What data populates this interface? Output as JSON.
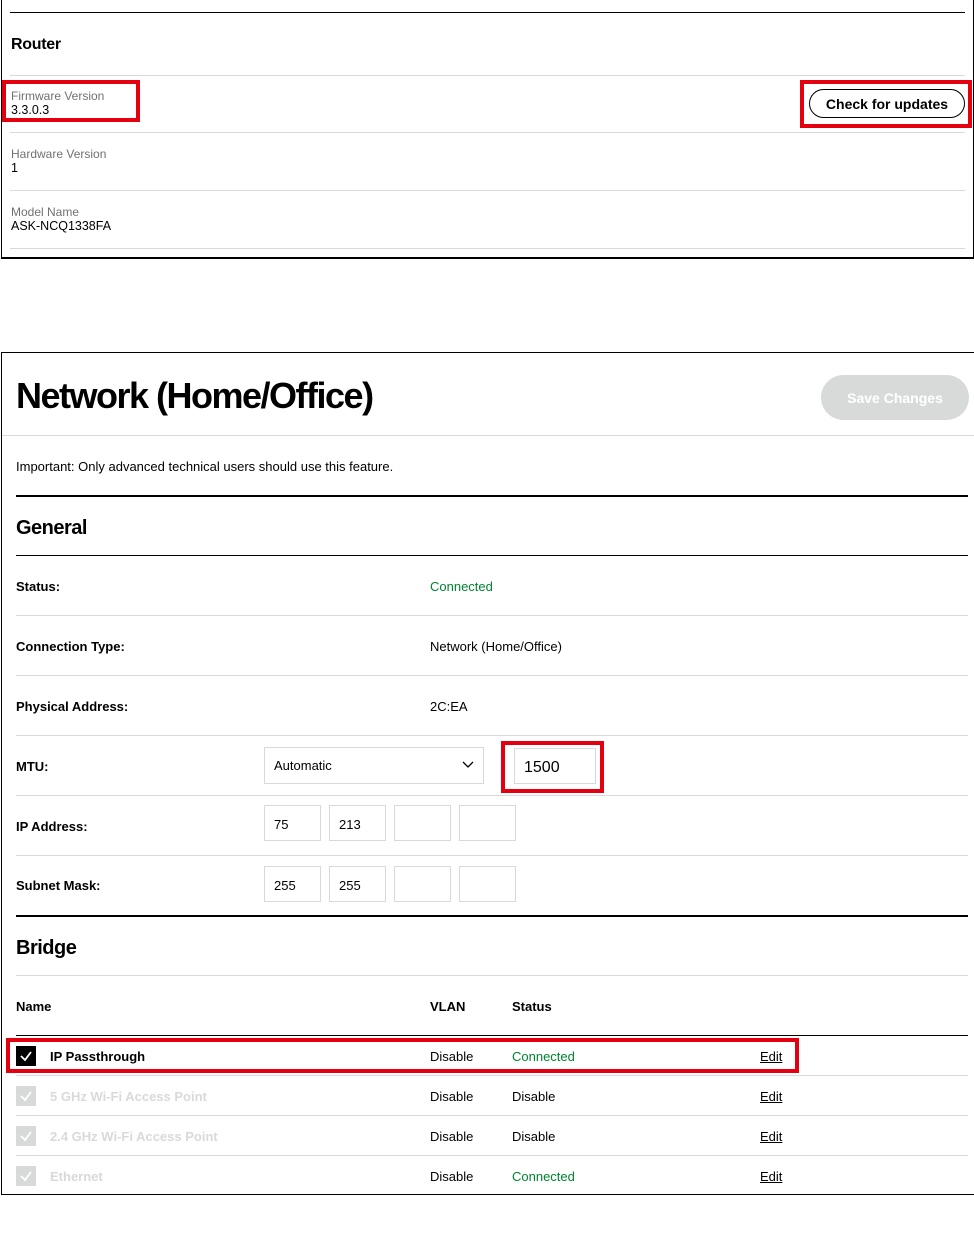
{
  "router": {
    "title": "Router",
    "firmware_label": "Firmware Version",
    "firmware_value": "3.3.0.3",
    "check_updates_label": "Check for updates",
    "hardware_label": "Hardware Version",
    "hardware_value": "1",
    "model_label": "Model Name",
    "model_value": "ASK-NCQ1338FA"
  },
  "network": {
    "title": "Network (Home/Office)",
    "save_label": "Save Changes",
    "notice": "Important: Only advanced technical users should use this feature.",
    "general": {
      "title": "General",
      "status_label": "Status:",
      "status_value": "Connected",
      "conn_type_label": "Connection Type:",
      "conn_type_value": "Network (Home/Office)",
      "phys_label": "Physical Address:",
      "phys_value": "2C:EA",
      "mtu_label": "MTU:",
      "mtu_mode": "Automatic",
      "mtu_value": "1500",
      "ip_label": "IP Address:",
      "ip_octets": [
        "75",
        "213",
        "",
        ""
      ],
      "subnet_label": "Subnet Mask:",
      "subnet_octets": [
        "255",
        "255",
        "",
        ""
      ]
    },
    "bridge": {
      "title": "Bridge",
      "headers": {
        "name": "Name",
        "vlan": "VLAN",
        "status": "Status"
      },
      "rows": [
        {
          "name": "IP Passthrough",
          "vlan": "Disable",
          "status": "Connected",
          "edit": "Edit",
          "checked": true,
          "enabled": true
        },
        {
          "name": "5 GHz Wi-Fi Access Point",
          "vlan": "Disable",
          "status": "Disable",
          "edit": "Edit",
          "checked": true,
          "enabled": false
        },
        {
          "name": "2.4 GHz Wi-Fi Access Point",
          "vlan": "Disable",
          "status": "Disable",
          "edit": "Edit",
          "checked": true,
          "enabled": false
        },
        {
          "name": "Ethernet",
          "vlan": "Disable",
          "status": "Connected",
          "edit": "Edit",
          "checked": true,
          "enabled": false
        }
      ]
    }
  },
  "colors": {
    "highlight": "#e3000f",
    "connected": "#008331",
    "disabled": "#d8dada"
  }
}
